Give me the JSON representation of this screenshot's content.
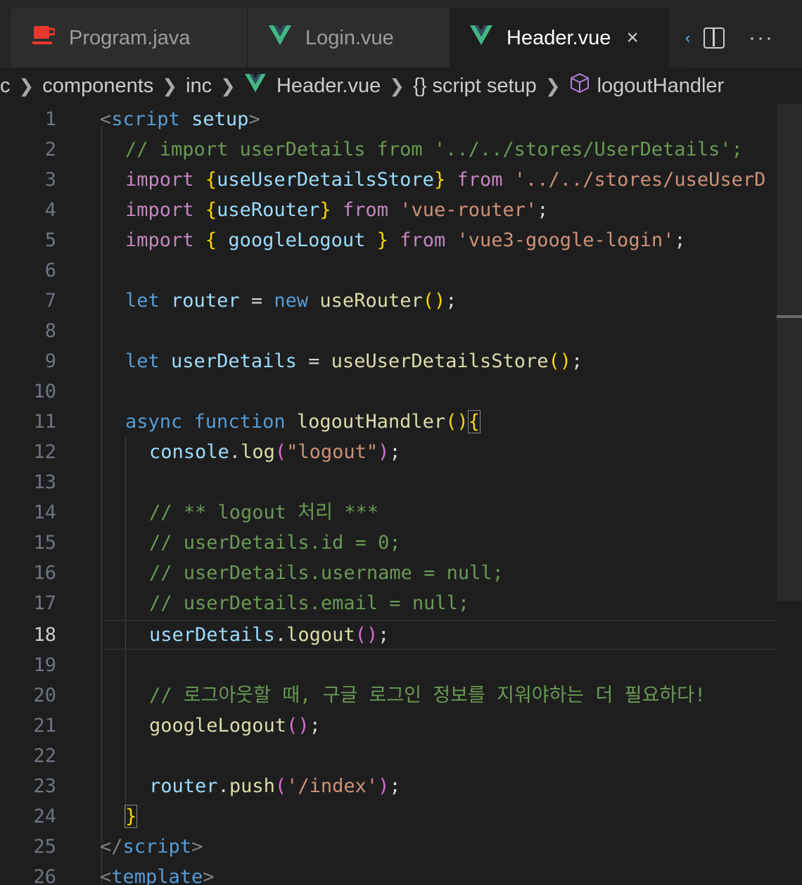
{
  "tabs": [
    {
      "label": "Program.java",
      "icon": "java-cup-icon",
      "active": false
    },
    {
      "label": "Login.vue",
      "icon": "vue-logo-icon",
      "active": false
    },
    {
      "label": "Header.vue",
      "icon": "vue-logo-icon",
      "active": true,
      "close": "×"
    }
  ],
  "tab_overflow": "‹",
  "tab_actions": {
    "split_icon": "split-editor-icon",
    "more": "···"
  },
  "breadcrumb": [
    "c",
    "components",
    "inc",
    "Header.vue",
    "{} script setup",
    "logoutHandler"
  ],
  "editor": {
    "current_line": 18,
    "line_numbers": [
      "1",
      "2",
      "3",
      "4",
      "5",
      "6",
      "7",
      "8",
      "9",
      "10",
      "11",
      "12",
      "13",
      "14",
      "15",
      "16",
      "17",
      "18",
      "19",
      "20",
      "21",
      "22",
      "23",
      "24",
      "25",
      "26"
    ],
    "lines": {
      "l1": {
        "p": "<",
        "tag": "script",
        "attr": "setup",
        "c": ">"
      },
      "l2": "// import userDetails from '../../stores/UserDetails';",
      "l3": {
        "kw": "import",
        "b": "{",
        "name": "useUserDetailsStore",
        "be": "}",
        "from": "from",
        "str": "'../../stores/useUserD"
      },
      "l4": {
        "kw": "import",
        "b": "{",
        "name": "useRouter",
        "be": "}",
        "from": "from",
        "str": "'vue-router'",
        "end": ";"
      },
      "l5": {
        "kw": "import",
        "b": "{",
        "name": " googleLogout ",
        "be": "}",
        "from": "from",
        "str": "'vue3-google-login'",
        "end": ";"
      },
      "l7": {
        "kw": "let",
        "name": "router",
        "eq": " = ",
        "new": "new",
        "fn": "useRouter",
        "b": "()",
        "end": ";"
      },
      "l9": {
        "kw": "let",
        "name": "userDetails",
        "eq": " = ",
        "fn": "useUserDetailsStore",
        "b": "()",
        "end": ";"
      },
      "l11": {
        "async": "async",
        "function": "function",
        "fn": "logoutHandler",
        "b": "()",
        "brace": "{"
      },
      "l12": {
        "obj": "console",
        "dot": ".",
        "fn": "log",
        "bo": "(",
        "str": "\"logout\"",
        "bc": ")",
        "end": ";"
      },
      "l14": "// ** logout 처리 ***",
      "l15": "// userDetails.id = 0;",
      "l16": "// userDetails.username = null;",
      "l17": "// userDetails.email = null;",
      "l18": {
        "obj": "userDetails",
        "dot": ".",
        "fn": "logout",
        "b": "()",
        "end": ";"
      },
      "l20": "// 로그아웃할 때, 구글 로그인 정보를 지워야하는 더 필요하다!",
      "l21": {
        "fn": "googleLogout",
        "b": "()",
        "end": ";"
      },
      "l23": {
        "obj": "router",
        "dot": ".",
        "fn": "push",
        "bo": "(",
        "str": "'/index'",
        "bc": ")",
        "end": ";"
      },
      "l24": "}",
      "l25": {
        "p": "</",
        "tag": "script",
        "c": ">"
      },
      "l26": {
        "p": "<",
        "tag": "template",
        "c": ">"
      }
    }
  }
}
